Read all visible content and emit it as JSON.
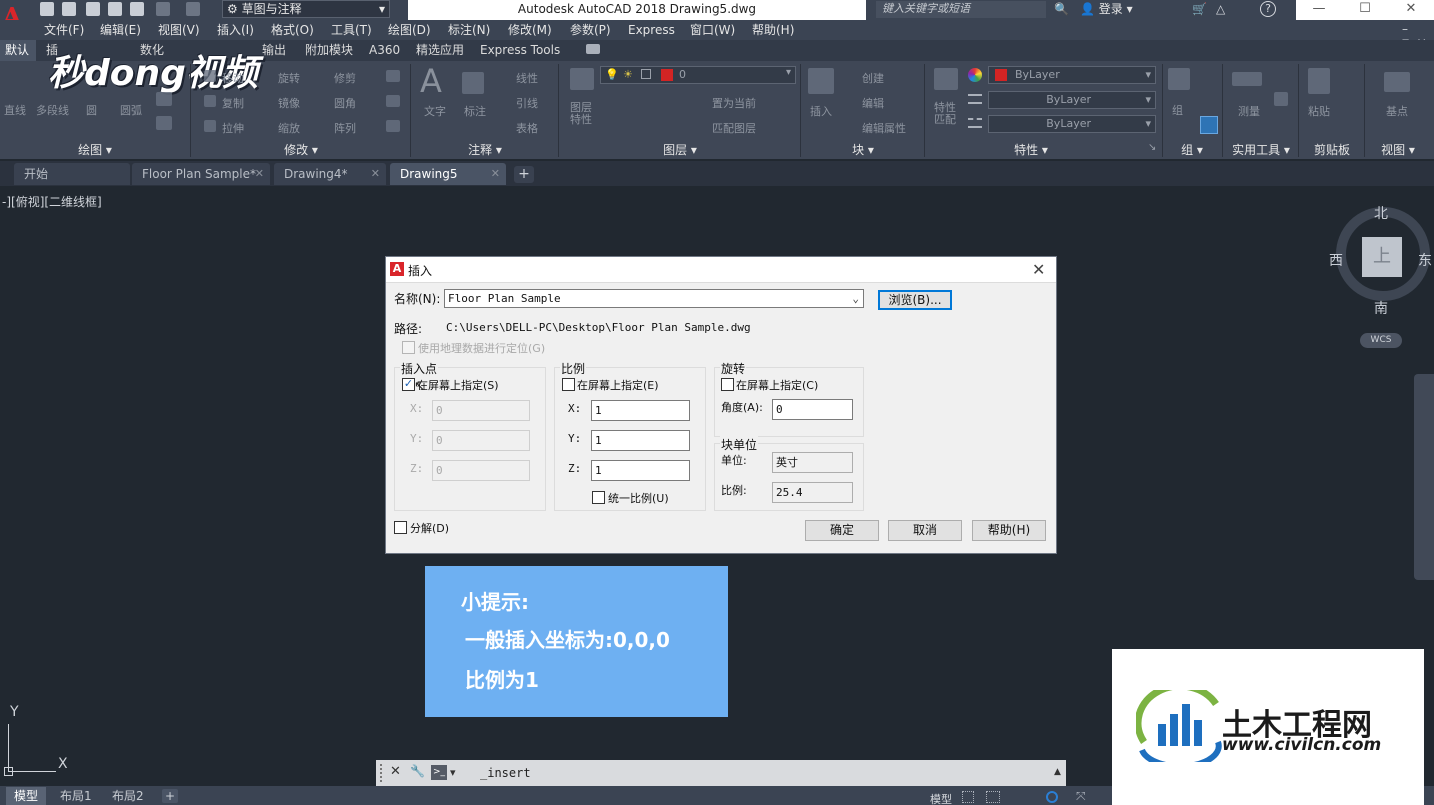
{
  "titlebar": {
    "app_logo": "A",
    "workspace": "草图与注释",
    "title": "Autodesk AutoCAD 2018    Drawing5.dwg",
    "search_placeholder": "键入关键字或短语",
    "login": "登录"
  },
  "menu": [
    "文件(F)",
    "编辑(E)",
    "视图(V)",
    "插入(I)",
    "格式(O)",
    "工具(T)",
    "绘图(D)",
    "标注(N)",
    "修改(M)",
    "参数(P)",
    "Express",
    "窗口(W)",
    "帮助(H)"
  ],
  "ribbon_tabs": [
    "默认",
    "插",
    "数化",
    "输出",
    "附加模块",
    "A360",
    "精选应用",
    "Express Tools"
  ],
  "brand_watermark": "秒dong视频",
  "ribbon": {
    "draw_labels": [
      "直线",
      "多段线",
      "圆",
      "圆弧"
    ],
    "modify_labels": [
      "移动",
      "旋转",
      "修剪",
      "复制",
      "镜像",
      "圆角",
      "拉伸",
      "缩放",
      "阵列"
    ],
    "annotate_labels": [
      "文字",
      "标注",
      "线性",
      "引线",
      "表格"
    ],
    "layer_current": "0",
    "layer_labels": [
      "图层特性",
      "置为当前",
      "匹配图层"
    ],
    "block_labels": [
      "插入",
      "创建",
      "编辑",
      "编辑属性"
    ],
    "properties_labels": [
      "特性匹配"
    ],
    "bylayer": [
      "ByLayer",
      "ByLayer",
      "ByLayer"
    ],
    "group_label": "组",
    "utility_label": "测量",
    "clipboard_label": "粘贴",
    "view_label": "基点",
    "panels": [
      "绘图 ▾",
      "修改 ▾",
      "注释 ▾",
      "图层 ▾",
      "块 ▾",
      "特性 ▾",
      "组 ▾",
      "实用工具 ▾",
      "剪贴板",
      "视图 ▾"
    ]
  },
  "doc_tabs": [
    "开始",
    "Floor Plan Sample*",
    "Drawing4*",
    "Drawing5"
  ],
  "viewport_label": "-][俯视][二维线框]",
  "viewcube": {
    "top": "上",
    "north": "北",
    "south": "南",
    "east": "东",
    "west": "西",
    "wcs": "WCS"
  },
  "dialog": {
    "title": "插入",
    "name_label": "名称(N):",
    "name_value": "Floor Plan Sample",
    "browse": "浏览(B)...",
    "path_label": "路径:",
    "path_value": "C:\\Users\\DELL-PC\\Desktop\\Floor Plan Sample.dwg",
    "geo_label": "使用地理数据进行定位(G)",
    "insert_point": {
      "title": "插入点",
      "specify": "在屏幕上指定(S)",
      "x_label": "X:",
      "x": "0",
      "y_label": "Y:",
      "y": "0",
      "z_label": "Z:",
      "z": "0"
    },
    "scale": {
      "title": "比例",
      "specify": "在屏幕上指定(E)",
      "x_label": "X:",
      "x": "1",
      "y_label": "Y:",
      "y": "1",
      "z_label": "Z:",
      "z": "1",
      "uniform": "统一比例(U)"
    },
    "rotation": {
      "title": "旋转",
      "specify": "在屏幕上指定(C)",
      "angle_label": "角度(A):",
      "angle": "0"
    },
    "block_unit": {
      "title": "块单位",
      "unit_label": "单位:",
      "unit": "英寸",
      "factor_label": "比例:",
      "factor": "25.4"
    },
    "explode": "分解(D)",
    "ok": "确定",
    "cancel": "取消",
    "help": "帮助(H)"
  },
  "tip": {
    "title": "小提示:",
    "line1": "一般插入坐标为:0,0,0",
    "line2": "比例为1"
  },
  "ucs": {
    "y": "Y",
    "x": "X"
  },
  "command": {
    "text": "_insert"
  },
  "layout_tabs": [
    "模型",
    "布局1",
    "布局2"
  ],
  "status": {
    "model": "模型"
  },
  "corner_watermark": {
    "title": "土木工程网",
    "url": "www.civilcn.com"
  }
}
